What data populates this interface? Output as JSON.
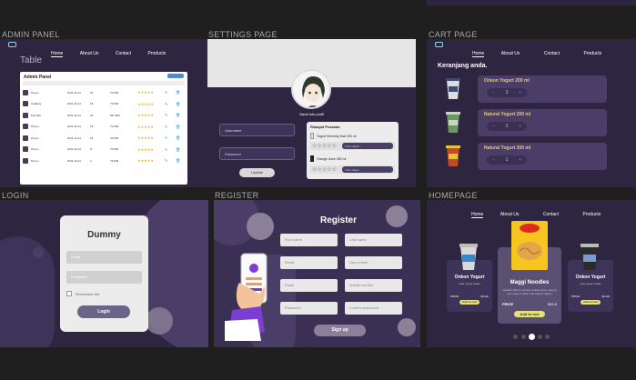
{
  "labels": {
    "admin": "ADMIN PANEL",
    "settings": "SETTINGS PAGE",
    "cart": "CART PAGE",
    "login": "LOGIN",
    "register": "REGISTER",
    "homepage": "HOMEPAGE"
  },
  "nav": [
    "Home",
    "About Us",
    "Contact",
    "Products"
  ],
  "admin": {
    "heading": "Table",
    "panel_title": "Admin Panel",
    "add_button": "",
    "rows": [
      {
        "name": "Ponyo",
        "c1": "2011-10-11",
        "c2": "23",
        "c3": "73.900",
        "stars": "★★★★★"
      },
      {
        "name": "Cadbury",
        "c1": "2011-10-11",
        "c2": "16",
        "c3": "73.500",
        "stars": "★★★★★"
      },
      {
        "name": "Pop Mie",
        "c1": "2011-10-11",
        "c2": "20",
        "c3": "38.7000",
        "stars": "★★★★★"
      },
      {
        "name": "Ponyo",
        "c1": "2011-10-11",
        "c2": "19",
        "c3": "73.500",
        "stars": "★★★★★"
      },
      {
        "name": "Ponyo",
        "c1": "2011-10-11",
        "c2": "15",
        "c3": "43.500",
        "stars": "★★★★★"
      },
      {
        "name": "Ponyo",
        "c1": "2011-10-11",
        "c2": "8",
        "c3": "73.500",
        "stars": "★★★★★"
      },
      {
        "name": "Ponyo",
        "c1": "2011-10-11",
        "c2": "4",
        "c3": "73.500",
        "stars": "★★★★★"
      }
    ]
  },
  "settings": {
    "caption": "Ganti foto profil",
    "username": "Username",
    "password": "Password",
    "update": "Update",
    "history_title": "Riwayat Pesanan",
    "item1": "Yogurt Kennedy Kiwi 200 ml",
    "item2": "Orange Juice 350 ml",
    "review_placeholder": "Tulis ulasan...",
    "stars": "☆☆☆☆☆"
  },
  "cart": {
    "heading": "Keranjang anda.",
    "items": [
      {
        "title": "Onkon Yogurt 200 ml",
        "qty": "2"
      },
      {
        "title": "Natural Yogurt 200 ml",
        "qty": "1"
      },
      {
        "title": "Natural Yogurt 200 ml",
        "qty": "1"
      }
    ]
  },
  "login": {
    "title": "Dummy",
    "email": "Email",
    "password": "Password",
    "remember": "Remember Me",
    "button": "Login"
  },
  "register": {
    "title": "Register",
    "first": "First name",
    "last": "Last name",
    "detail": "Detail",
    "dob": "Day of birth",
    "email": "Email",
    "mobile": "Mobile number",
    "password": "Password",
    "confirm": "Confirm password",
    "button": "Sign up"
  },
  "home": {
    "left": {
      "title": "Onkon Yogurt",
      "desc": "rasa yogurt segar",
      "price_label": "PRICE",
      "price": "Rp12k",
      "btn": "Add to cart"
    },
    "center": {
      "title": "Maggi Noodles",
      "desc": "noodles with 2 minutes cooking time, easy to eat, easy to taste, and easy to digest",
      "price_label": "PRICE",
      "price": "$25.5",
      "btn": "Add to cart"
    },
    "right": {
      "title": "Onkon Yogurt",
      "desc": "rasa yogurt segar",
      "price_label": "PRICE",
      "price": "Rp12k",
      "btn": "Add to cart"
    }
  },
  "colors": {
    "bg": "#1f1f1f",
    "panel": "#2e2640",
    "accent": "#e6e17a"
  }
}
